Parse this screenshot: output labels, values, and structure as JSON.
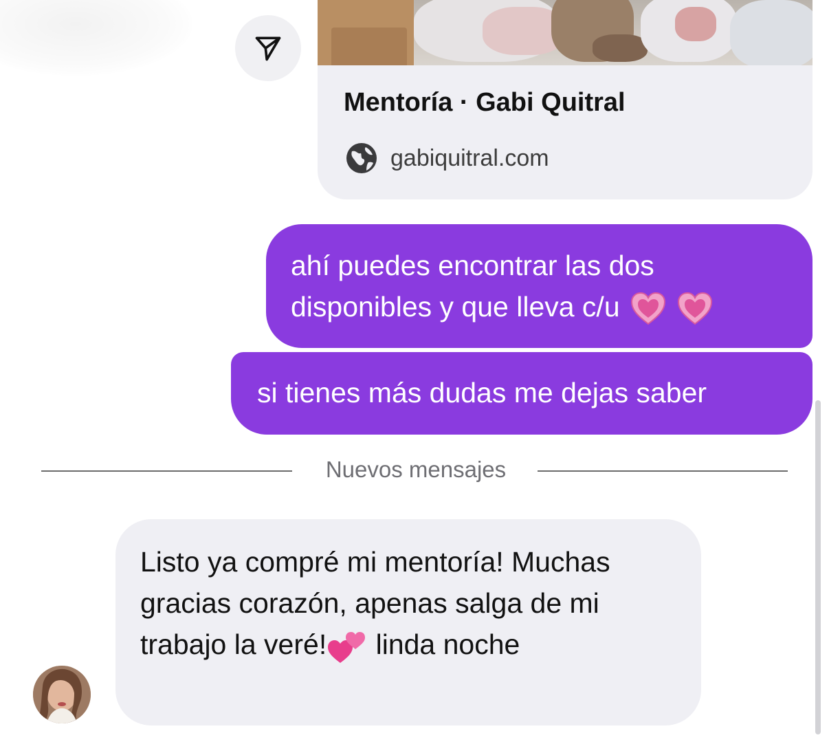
{
  "link_preview": {
    "title": "Mentoría · Gabi Quitral",
    "domain": "gabiquitral.com",
    "icon": "globe-icon"
  },
  "share_button": {
    "icon": "send-icon"
  },
  "outgoing_messages": [
    {
      "text": "ahí puedes encontrar las dos disponibles y que lleva c/u",
      "emoji": [
        "heart-icon",
        "heart-icon"
      ]
    },
    {
      "text": "si tienes más dudas me dejas saber"
    }
  ],
  "divider": {
    "label": "Nuevos mensajes"
  },
  "incoming_message": {
    "text_before_emoji": "Listo ya compré mi mentoría! Muchas gracias corazón, apenas salga de mi trabajo la veré!",
    "emoji": "two-hearts-icon",
    "text_after_emoji": " linda noche"
  },
  "colors": {
    "outgoing_bubble": "#8a3bdf",
    "incoming_bubble": "#efeff4",
    "divider_text": "#6e6e73"
  }
}
